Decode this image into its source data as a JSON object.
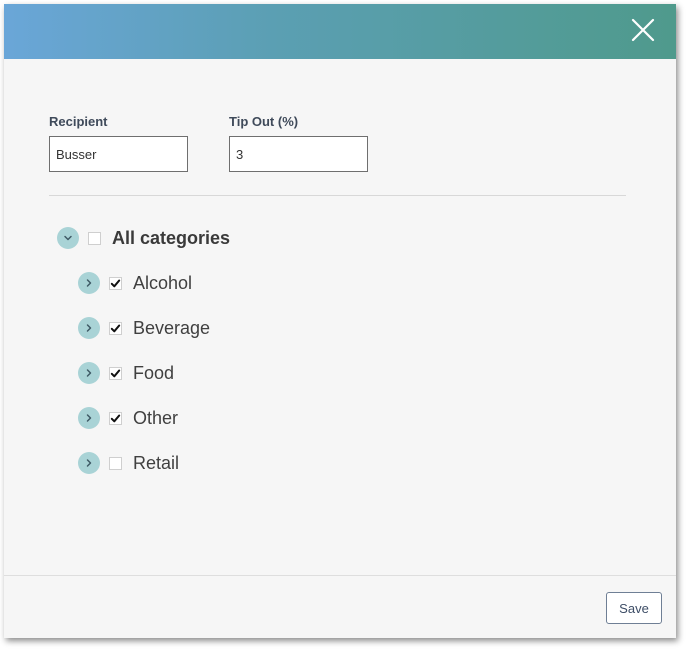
{
  "form": {
    "recipient_label": "Recipient",
    "recipient_value": "Busser",
    "tipout_label": "Tip Out (%)",
    "tipout_value": "3"
  },
  "categories": {
    "all": {
      "label": "All categories",
      "checked": false,
      "expanded": true
    },
    "items": [
      {
        "label": "Alcohol",
        "checked": true
      },
      {
        "label": "Beverage",
        "checked": true
      },
      {
        "label": "Food",
        "checked": true
      },
      {
        "label": "Other",
        "checked": true
      },
      {
        "label": "Retail",
        "checked": false
      }
    ]
  },
  "footer": {
    "save_label": "Save"
  },
  "icons": {
    "close": "close-icon",
    "expand": "chevron-right-icon",
    "collapse": "chevron-down-icon",
    "check": "checkmark-icon"
  },
  "colors": {
    "header_gradient_start": "#6aa6d8",
    "header_gradient_end": "#4f9a8c",
    "expander_bg": "#a9d3d6"
  }
}
